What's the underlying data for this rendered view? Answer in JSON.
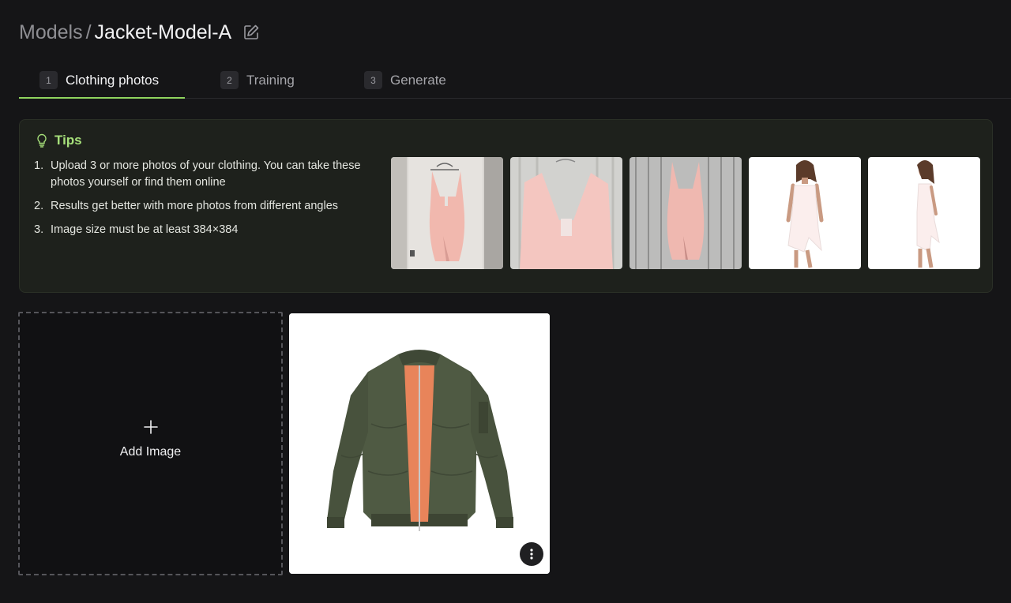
{
  "header": {
    "breadcrumb_parent": "Models",
    "separator": "/",
    "title": "Jacket-Model-A"
  },
  "tabs": [
    {
      "number": "1",
      "label": "Clothing photos",
      "active": true
    },
    {
      "number": "2",
      "label": "Training",
      "active": false
    },
    {
      "number": "3",
      "label": "Generate",
      "active": false
    }
  ],
  "tips": {
    "title": "Tips",
    "items": [
      {
        "num": "1.",
        "text": "Upload 3 or more photos of your clothing. You can take these photos yourself or find them online"
      },
      {
        "num": "2.",
        "text": "Results get better with more photos from different angles"
      },
      {
        "num": "3.",
        "text": "Image size must be at least 384×384"
      }
    ],
    "examples": [
      {
        "name": "pink-dress-on-hanger-door"
      },
      {
        "name": "pink-dress-closeup-wood"
      },
      {
        "name": "pink-dress-on-wood-wall"
      },
      {
        "name": "model-white-dress-front"
      },
      {
        "name": "model-white-dress-side"
      }
    ]
  },
  "upload": {
    "add_label": "Add Image"
  },
  "photos": [
    {
      "name": "green-bomber-jacket"
    }
  ],
  "colors": {
    "accent": "#8fd45e",
    "tips_title": "#a6e07a",
    "background": "#151517"
  }
}
